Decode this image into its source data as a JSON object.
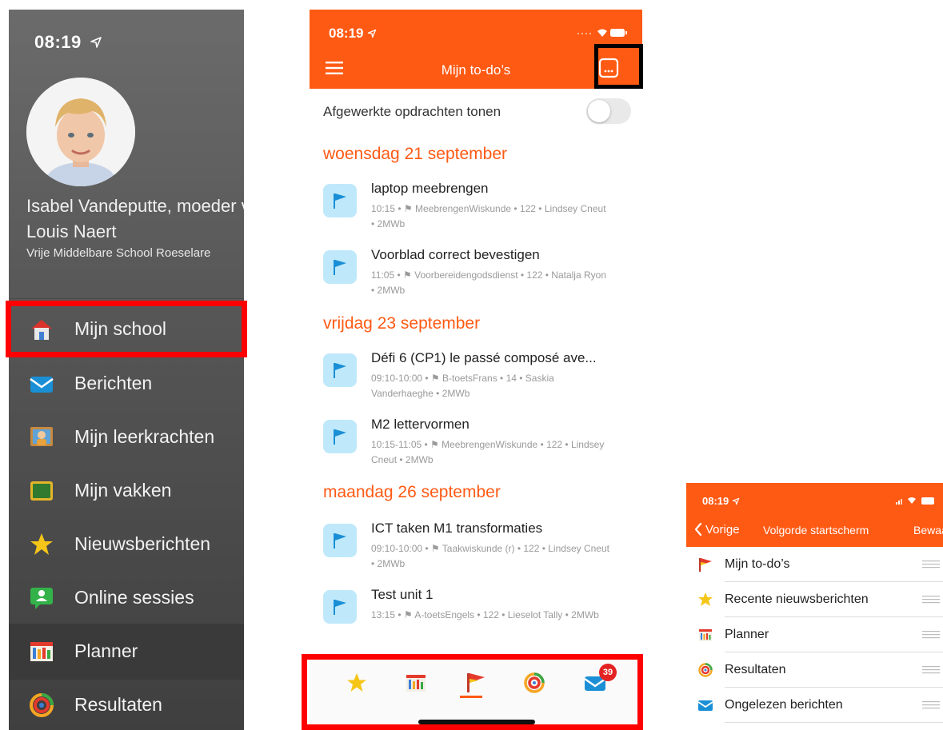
{
  "drawer": {
    "time": "08:19",
    "user_name": "Isabel Vandeputte, moeder van",
    "user_child": "Louis Naert",
    "school": "Vrije Middelbare School Roeselare",
    "items": [
      {
        "label": "Mijn school"
      },
      {
        "label": "Berichten"
      },
      {
        "label": "Mijn leerkrachten"
      },
      {
        "label": "Mijn vakken"
      },
      {
        "label": "Nieuwsberichten"
      },
      {
        "label": "Online sessies"
      },
      {
        "label": "Planner"
      },
      {
        "label": "Resultaten"
      }
    ]
  },
  "todo": {
    "time": "08:19",
    "title": "Mijn to-do’s",
    "toggle_label": "Afgewerkte opdrachten tonen",
    "days": [
      {
        "label": "woensdag 21 september",
        "tasks": [
          {
            "title": "laptop meebrengen",
            "meta": "10:15 • ⚑ MeebrengenWiskunde • 122 • Lindsey Cneut • 2MWb"
          },
          {
            "title": "Voorblad correct bevestigen",
            "meta": "11:05 • ⚑ Voorbereidengodsdienst • 122 • Natalja Ryon • 2MWb"
          }
        ]
      },
      {
        "label": "vrijdag 23 september",
        "tasks": [
          {
            "title": "Défi 6 (CP1) le passé composé ave...",
            "meta": "09:10-10:00 • ⚑ B-toetsFrans • 14 • Saskia Vanderhaeghe • 2MWb"
          },
          {
            "title": "M2 lettervormen",
            "meta": "10:15-11:05 • ⚑ MeebrengenWiskunde • 122 • Lindsey Cneut • 2MWb"
          }
        ]
      },
      {
        "label": "maandag 26 september",
        "tasks": [
          {
            "title": "ICT taken M1 transformaties",
            "meta": "09:10-10:00 • ⚑ Taakwiskunde (r) • 122 • Lindsey Cneut • 2MWb"
          },
          {
            "title": "Test unit 1",
            "meta": "13:15 • ⚑ A-toetsEngels • 122 • Lieselot Tally • 2MWb"
          }
        ]
      }
    ],
    "badge": "39",
    "icons": {
      "tab_1": "star-icon",
      "tab_2": "planner-icon",
      "tab_3": "flag-icon",
      "tab_4": "results-icon",
      "tab_5": "mail-icon"
    }
  },
  "order": {
    "time": "08:19",
    "back_label": "Vorige",
    "title": "Volgorde startscherm",
    "save_label": "Bewaar",
    "items": [
      {
        "label": "Mijn to-do’s"
      },
      {
        "label": "Recente nieuwsberichten"
      },
      {
        "label": "Planner"
      },
      {
        "label": "Resultaten"
      },
      {
        "label": "Ongelezen berichten"
      }
    ]
  },
  "colors": {
    "accent": "#ff5a14",
    "highlight": "#ff0000",
    "drawer_bg": "#555555",
    "flag_bg": "#bfe9fb",
    "flag": "#1a8fd6"
  }
}
